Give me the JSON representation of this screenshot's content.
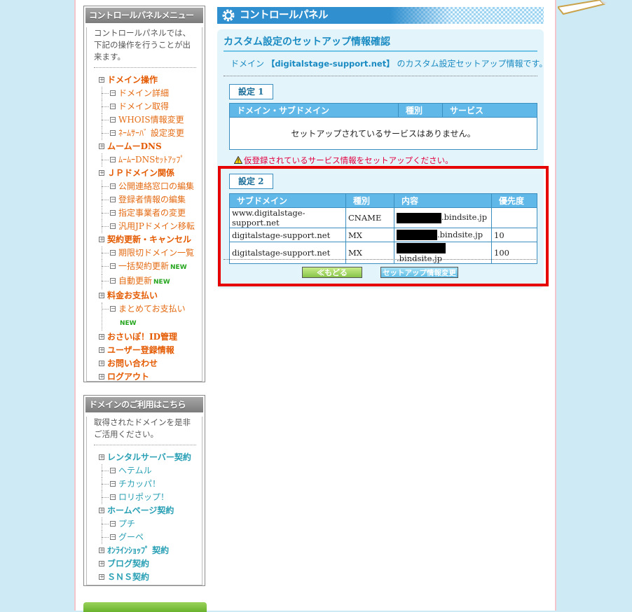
{
  "sidebar": {
    "menu_box": {
      "header": "コントロールパネルメニュー",
      "description": "コントロールパネルでは、下記の操作を行うことが出来ます。",
      "items": [
        {
          "label": "ドメイン操作",
          "level": "top"
        },
        {
          "label": "ドメイン詳細",
          "level": "sub"
        },
        {
          "label": "ドメイン取得",
          "level": "sub"
        },
        {
          "label": "WHOIS情報変更",
          "level": "sub"
        },
        {
          "label": "ﾈｰﾑｻｰﾊﾞ 設定変更",
          "level": "sub"
        },
        {
          "label": "ムームーDNS",
          "level": "top"
        },
        {
          "label": "ﾑｰﾑｰDNSｾｯﾄｱｯﾌﾟ",
          "level": "sub"
        },
        {
          "label": "ＪＰドメイン関係",
          "level": "top"
        },
        {
          "label": "公開連絡窓口の編集",
          "level": "sub"
        },
        {
          "label": "登録者情報の編集",
          "level": "sub"
        },
        {
          "label": "指定事業者の変更",
          "level": "sub"
        },
        {
          "label": "汎用JPドメイン移転",
          "level": "sub"
        },
        {
          "label": "契約更新・キャンセル",
          "level": "top"
        },
        {
          "label": "期限切ドメイン一覧",
          "level": "sub"
        },
        {
          "label": "一括契約更新",
          "level": "sub",
          "badge": "NEW"
        },
        {
          "label": "自動更新",
          "level": "sub",
          "badge": "NEW"
        },
        {
          "label": "料金お支払い",
          "level": "top"
        },
        {
          "label": "まとめてお支払い",
          "level": "sub",
          "badge": "NEW"
        },
        {
          "label": "おさいぽ！ID管理",
          "level": "top"
        },
        {
          "label": "ユーザー登録情報",
          "level": "top"
        },
        {
          "label": "お問い合わせ",
          "level": "top"
        },
        {
          "label": "ログアウト",
          "level": "top"
        }
      ]
    },
    "domain_box": {
      "header": "ドメインのご利用はこちら",
      "description": "取得されたドメインを是非ご活用ください。",
      "items": [
        {
          "label": "レンタルサーバー契約",
          "level": "top"
        },
        {
          "label": "ヘテムル",
          "level": "sub"
        },
        {
          "label": "チカッパ！",
          "level": "sub"
        },
        {
          "label": "ロリポップ！",
          "level": "sub"
        },
        {
          "label": "ホームページ契約",
          "level": "top"
        },
        {
          "label": "プチ",
          "level": "sub"
        },
        {
          "label": "グーペ",
          "level": "sub"
        },
        {
          "label": "ｵﾝﾗｲﾝｼｮｯﾌﾟ 契約",
          "level": "top"
        },
        {
          "label": "ブログ契約",
          "level": "top"
        },
        {
          "label": "ＳＮＳ契約",
          "level": "top"
        }
      ]
    }
  },
  "main": {
    "header_title": "コントロールパネル",
    "panel_title": "カスタム設定のセットアップ情報確認",
    "intro_prefix": "ドメイン ",
    "intro_domain": "【digitalstage-support.net】",
    "intro_suffix": " のカスタム設定セットアップ情報です。",
    "setting1": {
      "label": "設定 1",
      "headers": [
        "ドメイン・サブドメイン",
        "種別",
        "サービス"
      ],
      "empty_message": "セットアップされているサービスはありません。"
    },
    "warning": "仮登録されているサービス情報をセットアップください。",
    "setting2": {
      "label": "設定 2",
      "headers": [
        "サブドメイン",
        "種別",
        "内容",
        "優先度"
      ],
      "rows": [
        {
          "subdomain": "www.digitalstage-support.net",
          "type": "CNAME",
          "content_suffix": ".bindsite.jp",
          "priority": ""
        },
        {
          "subdomain": "digitalstage-support.net",
          "type": "MX",
          "content_suffix": ".bindsite.jp",
          "priority": "10"
        },
        {
          "subdomain": "digitalstage-support.net",
          "type": "MX",
          "content_suffix": ".bindsite.jp",
          "priority": "100"
        }
      ]
    },
    "buttons": {
      "back": "≪もどる",
      "edit": "セットアップ情報変更"
    }
  }
}
